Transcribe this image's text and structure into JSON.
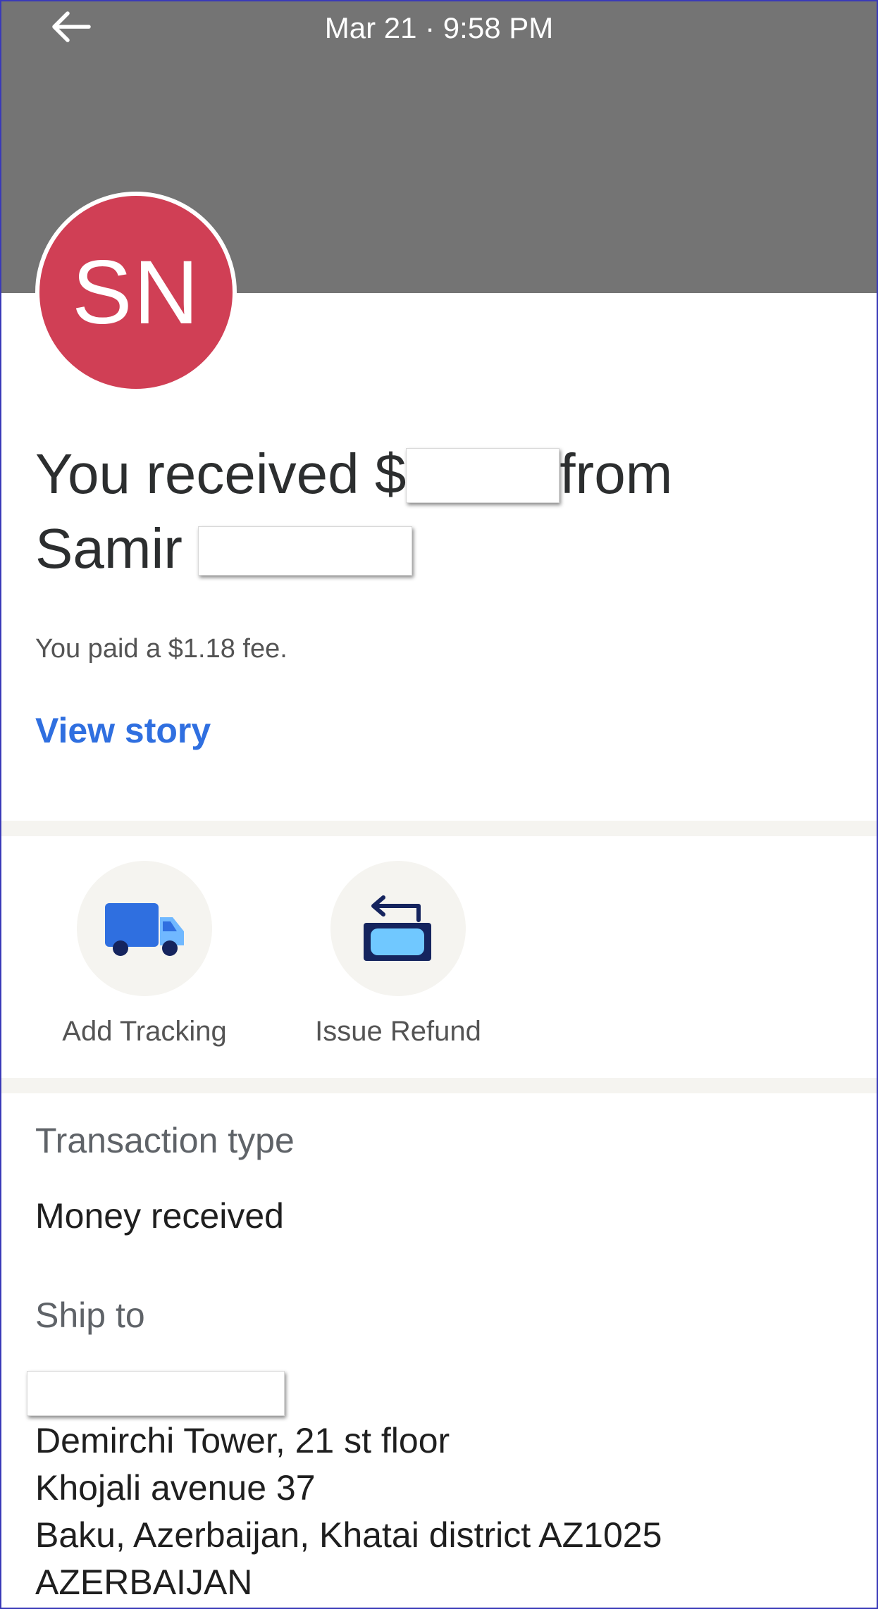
{
  "header": {
    "date_time": "Mar 21 · 9:58 PM",
    "back_icon": "arrow-left-icon",
    "background_color": "#747474"
  },
  "avatar": {
    "initials": "SN",
    "color": "#d03f55"
  },
  "summary": {
    "title_part1": "You received $",
    "title_part2": "from",
    "title_name": "Samir",
    "fee_text": "You paid a $1.18 fee.",
    "view_story_label": "View story",
    "link_color": "#2f6fe0"
  },
  "actions": [
    {
      "label": "Add Tracking",
      "icon": "truck-icon"
    },
    {
      "label": "Issue Refund",
      "icon": "refund-icon"
    }
  ],
  "details": {
    "transaction_type_label": "Transaction type",
    "transaction_type_value": "Money received",
    "ship_to_label": "Ship to",
    "address_lines": [
      "Demirchi Tower, 21 st floor",
      "Khojali avenue 37",
      "Baku, Azerbaijan, Khatai district AZ1025",
      "AZERBAIJAN"
    ]
  }
}
